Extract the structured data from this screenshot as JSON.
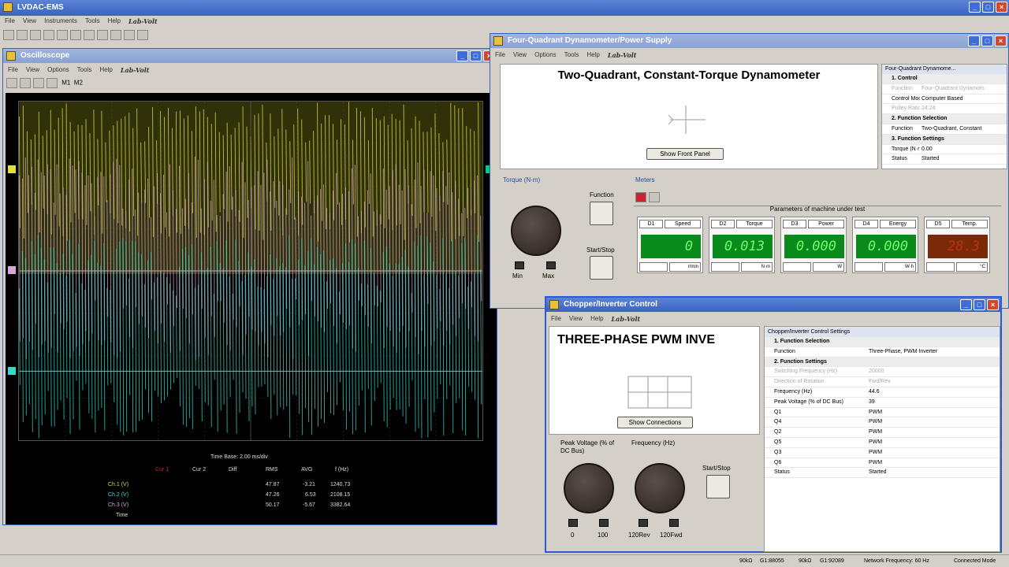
{
  "app": {
    "title": "LVDAC-EMS",
    "menu": [
      "File",
      "View",
      "Instruments",
      "Tools",
      "Help"
    ],
    "logo": "Lab-Volt"
  },
  "oscilloscope": {
    "title": "Oscilloscope",
    "menu": [
      "File",
      "View",
      "Options",
      "Tools",
      "Help"
    ],
    "logo": "Lab-Volt",
    "toolbar": [
      "M1",
      "M2"
    ],
    "timebase": "Time Base: 2.00 ms/div",
    "headers": [
      "Cur 1",
      "Cur 2",
      "Diff",
      "RMS",
      "AVG",
      "f (Hz)"
    ],
    "rows": [
      {
        "label": "Ch.1 (V)",
        "rms": "47.87",
        "avg": "-3.21",
        "f": "1240.73"
      },
      {
        "label": "Ch.2 (V)",
        "rms": "47.26",
        "avg": "6.53",
        "f": "2108.15"
      },
      {
        "label": "Ch.3 (V)",
        "rms": "50.17",
        "avg": "-5.67",
        "f": "3382.64"
      }
    ],
    "time_label": "Time"
  },
  "dyno": {
    "title": "Four-Quadrant Dynamometer/Power Supply",
    "menu": [
      "File",
      "View",
      "Options",
      "Tools",
      "Help"
    ],
    "logo": "Lab-Volt",
    "heading": "Two-Quadrant, Constant-Torque Dynamometer",
    "show_front_panel": "Show Front Panel",
    "torque_label": "Torque (N·m)",
    "min": "Min",
    "max": "Max",
    "function_label": "Function",
    "startstop_label": "Start/Stop",
    "meters_label": "Meters",
    "params_label": "Parameters of machine under test",
    "meters": [
      {
        "id": "D1",
        "name": "Speed",
        "value": "0",
        "unit": "r/min"
      },
      {
        "id": "D2",
        "name": "Torque",
        "value": "0.013",
        "unit": "N·m"
      },
      {
        "id": "D3",
        "name": "Power",
        "value": "0.000",
        "unit": "W"
      },
      {
        "id": "D4",
        "name": "Energy",
        "value": "0.000",
        "unit": "W·h"
      },
      {
        "id": "D5",
        "name": "Temp.",
        "value": "28.3",
        "unit": "°C"
      }
    ],
    "props_title": "Four-Quadrant Dynamome...",
    "props": [
      {
        "k": "1. Control",
        "v": "",
        "hdr": true
      },
      {
        "k": "Function",
        "v": "Four-Quadrant Dynamom",
        "dis": true
      },
      {
        "k": "Control Moc",
        "v": "Computer Based"
      },
      {
        "k": "Pulley Ratio",
        "v": "24:24",
        "dis": true
      },
      {
        "k": "2. Function Selection",
        "v": "",
        "hdr": true
      },
      {
        "k": "Function",
        "v": "Two-Quadrant, Constant"
      },
      {
        "k": "3. Function Settings",
        "v": "",
        "hdr": true
      },
      {
        "k": "Torque (N·r",
        "v": "0.00"
      },
      {
        "k": "Status",
        "v": "Started"
      }
    ]
  },
  "chopper": {
    "title": "Chopper/Inverter Control",
    "menu": [
      "File",
      "View",
      "Help"
    ],
    "logo": "Lab-Volt",
    "heading": "THREE-PHASE  PWM INVE",
    "show_connections": "Show Connections",
    "peak_label": "Peak Voltage (% of DC Bus)",
    "freq_label": "Frequency (Hz)",
    "startstop_label": "Start/Stop",
    "k1_min": "0",
    "k1_max": "100",
    "k2_min": "120Rev",
    "k2_max": "120Fwd",
    "props_title": "Chopper/Inverter Control Settings",
    "props": [
      {
        "k": "1. Function Selection",
        "v": "",
        "hdr": true
      },
      {
        "k": "Function",
        "v": "Three-Phase, PWM Inverter"
      },
      {
        "k": "2. Function Settings",
        "v": "",
        "hdr": true
      },
      {
        "k": "Switching Frequency (Hz)",
        "v": "20000",
        "dis": true
      },
      {
        "k": "Direction of Rotation",
        "v": "Fwd/Rev",
        "dis": true
      },
      {
        "k": "Frequency (Hz)",
        "v": "44.6"
      },
      {
        "k": "Peak Voltage (% of DC Bus)",
        "v": "39"
      },
      {
        "k": "Q1",
        "v": "PWM"
      },
      {
        "k": "Q4",
        "v": "PWM"
      },
      {
        "k": "Q2",
        "v": "PWM"
      },
      {
        "k": "Q5",
        "v": "PWM"
      },
      {
        "k": "Q3",
        "v": "PWM"
      },
      {
        "k": "Q6",
        "v": "PWM"
      },
      {
        "k": "Status",
        "v": "Started"
      }
    ]
  },
  "statusbar": {
    "items": [
      "90kΩ",
      "G1:88055",
      "90kΩ",
      "G1:92089",
      "Network Frequency: 60 Hz",
      "Connected Mode"
    ]
  }
}
